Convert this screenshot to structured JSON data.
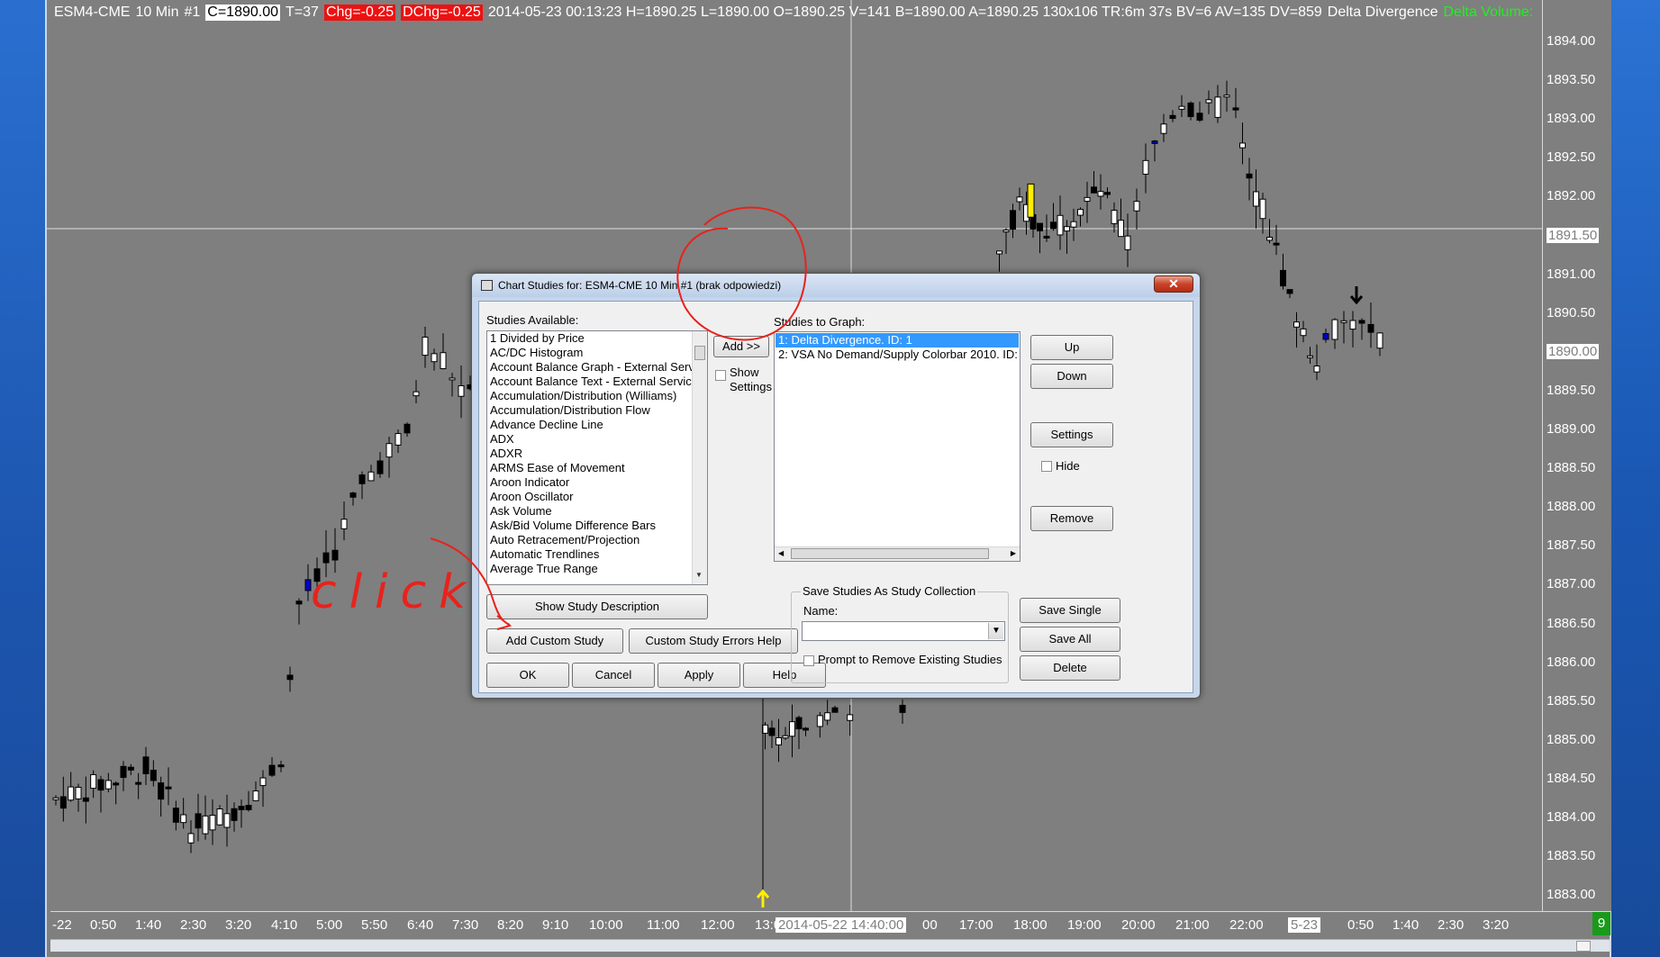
{
  "chart": {
    "header": {
      "symbol": "ESM4-CME",
      "interval": "10 Min",
      "chart_no": "#1",
      "close": "C=1890.00",
      "trades": "T=37",
      "chg": "Chg=-0.25",
      "dchg": "DChg=-0.25",
      "stats": "2014-05-23 00:13:23 H=1890.25 L=1890.00 O=1890.25 V=141 B=1890.00 A=1890.25 130x106 TR:6m 37s BV=6 AV=135 DV=859",
      "study": "Delta Divergence",
      "study2": "Delta Volume:"
    },
    "y_ticks": [
      "1894.00",
      "1893.50",
      "1893.00",
      "1892.50",
      "1892.00",
      "1891.50",
      "1891.00",
      "1890.50",
      "1890.00",
      "1889.50",
      "1889.00",
      "1888.50",
      "1888.00",
      "1887.50",
      "1887.00",
      "1886.50",
      "1886.00",
      "1885.50",
      "1885.00",
      "1884.50",
      "1884.00",
      "1883.50",
      "1883.00"
    ],
    "y_highlight": [
      "1891.50",
      "1890.00"
    ],
    "x_ticks": [
      "-22",
      "0:50",
      "1:40",
      "2:30",
      "3:20",
      "4:10",
      "5:00",
      "5:50",
      "6:40",
      "7:30",
      "8:20",
      "9:10",
      "10:00",
      "11:00",
      "12:00",
      "13:00",
      "17:00",
      "18:00",
      "19:00",
      "20:00",
      "21:00",
      "22:00",
      "5-23",
      "0:50",
      "1:40",
      "2:30",
      "3:20"
    ],
    "x_cursor_label": "2014-05-22  14:40:00",
    "x_cursor_suffix": "00",
    "corner_badge": "9",
    "colors": {
      "background": "#7f7f7f",
      "up": "#ffffff",
      "down": "#000000",
      "blue_bar": "#0000cc",
      "yellow_bar": "#ffee00"
    }
  },
  "dialog": {
    "title": "Chart Studies for: ESM4-CME  10 Min   #1 (brak odpowiedzi)",
    "close_label": "✕",
    "studies_available_label": "Studies Available:",
    "studies_available": [
      "1 Divided by Price",
      "AC/DC Histogram",
      "Account Balance Graph - External Service",
      "Account Balance Text - External Service",
      "Accumulation/Distribution (Williams)",
      "Accumulation/Distribution Flow",
      "Advance Decline Line",
      "ADX",
      "ADXR",
      "ARMS Ease of Movement",
      "Aroon Indicator",
      "Aroon Oscillator",
      "Ask Volume",
      "Ask/Bid Volume Difference Bars",
      "Auto Retracement/Projection",
      "Automatic Trendlines",
      "Average True Range"
    ],
    "add_label": "Add >>",
    "show_settings_label_1": "Show",
    "show_settings_label_2": "Settings",
    "studies_to_graph_label": "Studies to Graph:",
    "studies_to_graph": [
      "1: Delta Divergence. ID: 1",
      "2: VSA No Demand/Supply Colorbar 2010. ID:"
    ],
    "up_label": "Up",
    "down_label": "Down",
    "settings_label": "Settings",
    "hide_label": "Hide",
    "remove_label": "Remove",
    "show_desc_label": "Show Study Description",
    "add_custom_label": "Add Custom Study",
    "custom_errors_label": "Custom Study Errors Help",
    "ok_label": "OK",
    "cancel_label": "Cancel",
    "apply_label": "Apply",
    "help_label": "Help",
    "save_group_label": "Save Studies As Study Collection",
    "name_label": "Name:",
    "name_value": "",
    "prompt_remove_label": "Prompt to Remove Existing Studies",
    "save_single_label": "Save Single",
    "save_all_label": "Save All",
    "delete_label": "Delete"
  },
  "annotation": {
    "text": "click",
    "color": "#e8221c"
  }
}
